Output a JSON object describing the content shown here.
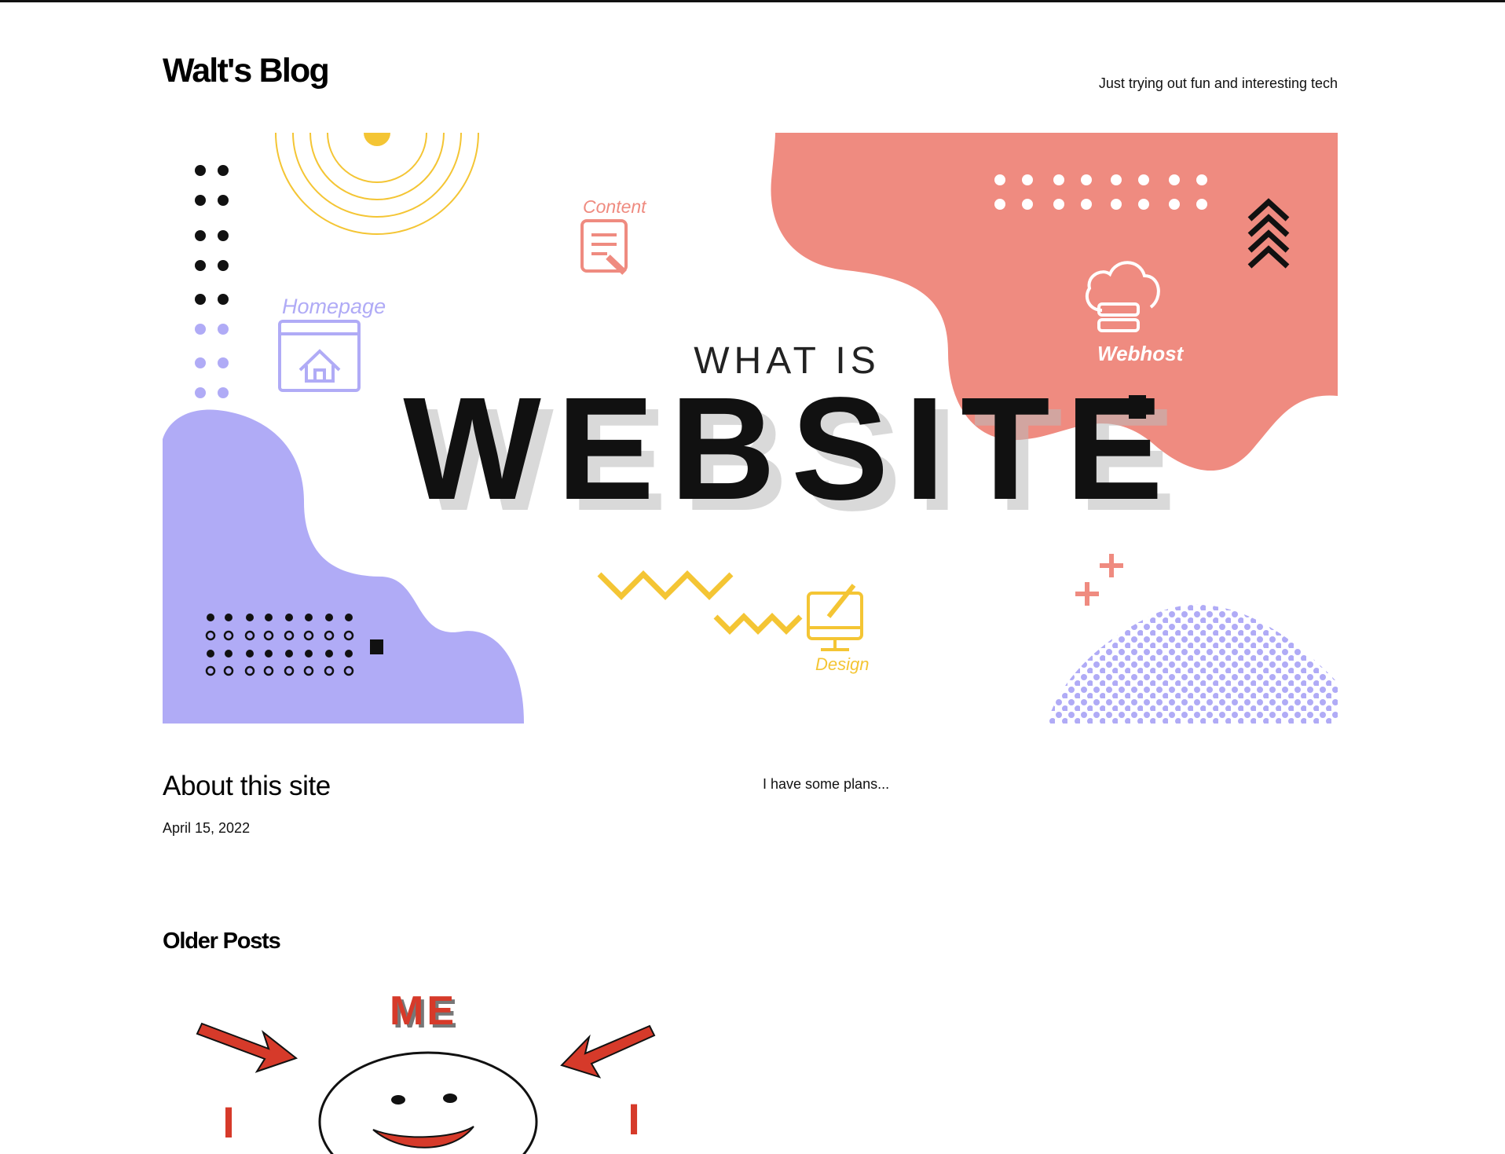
{
  "header": {
    "site_title": "Walt's Blog",
    "tagline": "Just trying out fun and interesting tech"
  },
  "hero": {
    "line1": "WHAT IS",
    "line2": "WEBSITE",
    "label_content": "Content",
    "label_homepage": "Homepage",
    "label_webhost": "Webhost",
    "label_design": "Design"
  },
  "post": {
    "title": "About this site",
    "date": "April 15, 2022",
    "excerpt": "I have some plans..."
  },
  "older": {
    "heading": "Older Posts",
    "thumb_me": "ME",
    "thumb_i_left": "I",
    "thumb_i_right": "I"
  },
  "colors": {
    "coral": "#ef8b80",
    "lavender": "#b0abf6",
    "yellow": "#f4c534",
    "dark": "#111111"
  }
}
